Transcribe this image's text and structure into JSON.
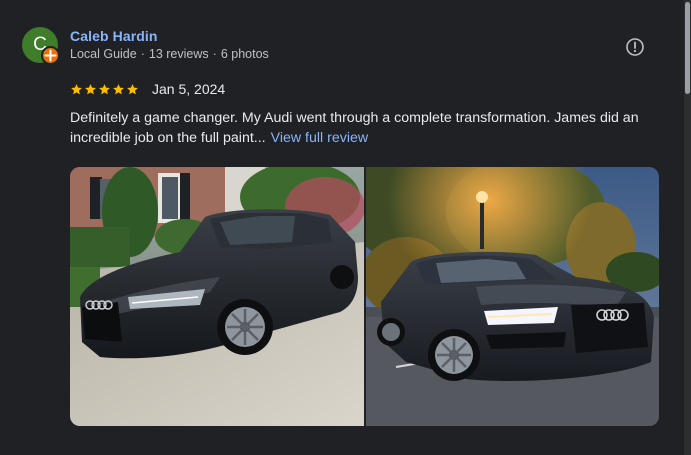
{
  "reviewer": {
    "initial": "C",
    "name": "Caleb Hardin",
    "badge_icon": "local-guide-star-icon",
    "local_guide": "Local Guide",
    "reviews": "13 reviews",
    "photos": "6 photos",
    "separator": "·"
  },
  "rating": {
    "stars": 5,
    "max_stars": 5,
    "date": "Jan 5, 2024",
    "star_color": "#fbbc04"
  },
  "review": {
    "text": "Definitely a game changer. My Audi went through a complete transformation. James did an incredible job on the full paint...",
    "view_full": "View full review"
  },
  "photos": [
    {
      "description_icon": "car-photo-icon"
    },
    {
      "description_icon": "car-photo-icon"
    }
  ],
  "colors": {
    "background": "#202124",
    "link": "#8ab4f8",
    "avatar": "#3f7d2a",
    "badge": "#e8710a"
  }
}
